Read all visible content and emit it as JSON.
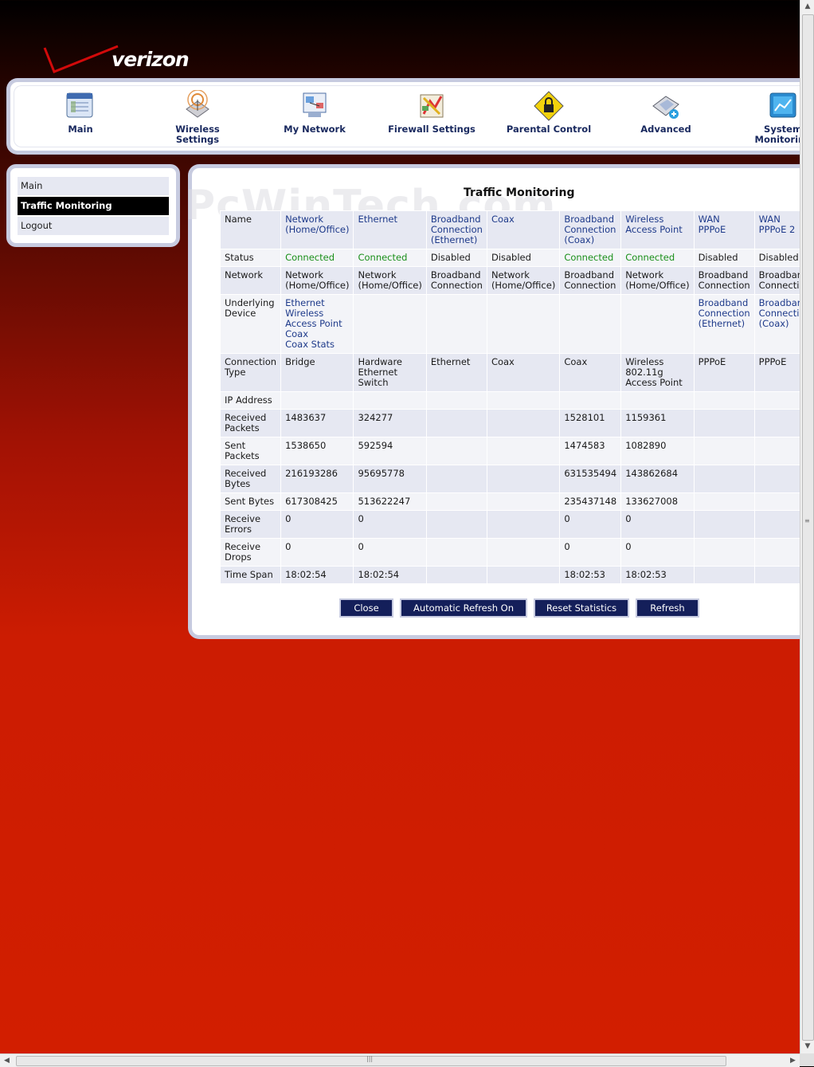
{
  "brand": {
    "logo_text": "verizon",
    "accent": "#cc0000"
  },
  "watermark": "PcWinTech.com",
  "topnav": [
    {
      "label": "Main",
      "icon": "main-icon"
    },
    {
      "label": "Wireless Settings",
      "icon": "wireless-settings-icon"
    },
    {
      "label": "My Network",
      "icon": "my-network-icon"
    },
    {
      "label": "Firewall Settings",
      "icon": "firewall-settings-icon"
    },
    {
      "label": "Parental Control",
      "icon": "parental-control-icon"
    },
    {
      "label": "Advanced",
      "icon": "advanced-icon"
    },
    {
      "label": "System Monitoring",
      "icon": "system-monitoring-icon"
    }
  ],
  "sidebar": [
    {
      "label": "Main",
      "active": false
    },
    {
      "label": "Traffic Monitoring",
      "active": true
    },
    {
      "label": "Logout",
      "active": false
    }
  ],
  "page": {
    "title": "Traffic Monitoring"
  },
  "table": {
    "row_labels": {
      "name": "Name",
      "status": "Status",
      "network": "Network",
      "underlying": "Underlying Device",
      "conn_type": "Connection Type",
      "ip": "IP Address",
      "rx_packets": "Received Packets",
      "tx_packets": "Sent Packets",
      "rx_bytes": "Received Bytes",
      "tx_bytes": "Sent Bytes",
      "rx_errors": "Receive Errors",
      "rx_drops": "Receive Drops",
      "time_span": "Time Span"
    },
    "columns": [
      {
        "name": "Network (Home/Office)",
        "status": "Connected",
        "network": "Network (Home/Office)",
        "underlying": [
          "Ethernet",
          "Wireless Access Point",
          "Coax",
          "Coax Stats"
        ],
        "conn_type": "Bridge",
        "ip": "",
        "rx_packets": "1483637",
        "tx_packets": "1538650",
        "rx_bytes": "216193286",
        "tx_bytes": "617308425",
        "rx_errors": "0",
        "rx_drops": "0",
        "time_span": "18:02:54"
      },
      {
        "name": "Ethernet",
        "status": "Connected",
        "network": "Network (Home/Office)",
        "underlying": [],
        "conn_type": "Hardware Ethernet Switch",
        "ip": "",
        "rx_packets": "324277",
        "tx_packets": "592594",
        "rx_bytes": "95695778",
        "tx_bytes": "513622247",
        "rx_errors": "0",
        "rx_drops": "0",
        "time_span": "18:02:54"
      },
      {
        "name": "Broadband Connection (Ethernet)",
        "status": "Disabled",
        "network": "Broadband Connection",
        "underlying": [],
        "conn_type": "Ethernet",
        "ip": "",
        "rx_packets": "",
        "tx_packets": "",
        "rx_bytes": "",
        "tx_bytes": "",
        "rx_errors": "",
        "rx_drops": "",
        "time_span": ""
      },
      {
        "name": "Coax",
        "status": "Disabled",
        "network": "Network (Home/Office)",
        "underlying": [],
        "conn_type": "Coax",
        "ip": "",
        "rx_packets": "",
        "tx_packets": "",
        "rx_bytes": "",
        "tx_bytes": "",
        "rx_errors": "",
        "rx_drops": "",
        "time_span": ""
      },
      {
        "name": "Broadband Connection (Coax)",
        "status": "Connected",
        "network": "Broadband Connection",
        "underlying": [],
        "conn_type": "Coax",
        "ip": "",
        "rx_packets": "1528101",
        "tx_packets": "1474583",
        "rx_bytes": "631535494",
        "tx_bytes": "235437148",
        "rx_errors": "0",
        "rx_drops": "0",
        "time_span": "18:02:53"
      },
      {
        "name": "Wireless Access Point",
        "status": "Connected",
        "network": "Network (Home/Office)",
        "underlying": [],
        "conn_type": "Wireless 802.11g Access Point",
        "ip": "",
        "rx_packets": "1159361",
        "tx_packets": "1082890",
        "rx_bytes": "143862684",
        "tx_bytes": "133627008",
        "rx_errors": "0",
        "rx_drops": "0",
        "time_span": "18:02:53"
      },
      {
        "name": "WAN PPPoE",
        "status": "Disabled",
        "network": "Broadband Connection",
        "underlying": [
          "Broadband Connection (Ethernet)"
        ],
        "conn_type": "PPPoE",
        "ip": "",
        "rx_packets": "",
        "tx_packets": "",
        "rx_bytes": "",
        "tx_bytes": "",
        "rx_errors": "",
        "rx_drops": "",
        "time_span": ""
      },
      {
        "name": "WAN PPPoE 2",
        "status": "Disabled",
        "network": "Broadband Connection",
        "underlying": [
          "Broadband Connection (Coax)"
        ],
        "conn_type": "PPPoE",
        "ip": "",
        "rx_packets": "",
        "tx_packets": "",
        "rx_bytes": "",
        "tx_bytes": "",
        "rx_errors": "",
        "rx_drops": "",
        "time_span": ""
      }
    ]
  },
  "buttons": [
    {
      "label": "Close"
    },
    {
      "label": "Automatic Refresh On"
    },
    {
      "label": "Reset Statistics"
    },
    {
      "label": "Refresh"
    }
  ]
}
